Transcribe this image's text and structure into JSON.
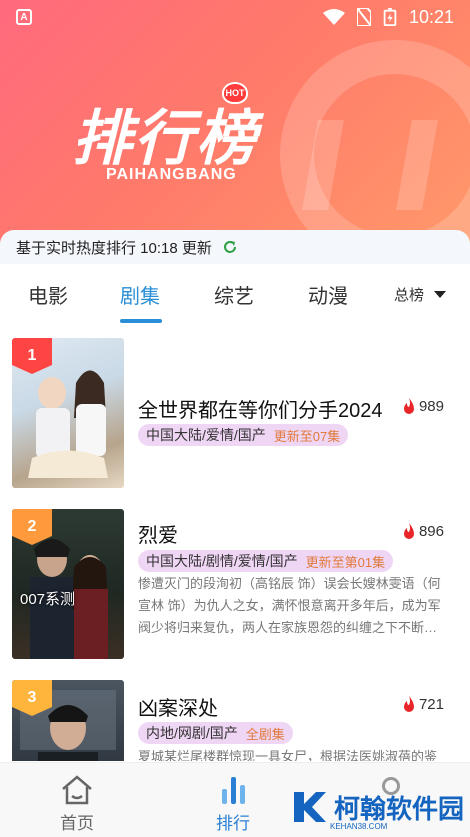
{
  "status": {
    "time": "10:21",
    "app_icon": "A"
  },
  "header": {
    "title": "排行榜",
    "subtitle": "PAIHANGBANG",
    "hot": "HOT"
  },
  "update": {
    "text": "基于实时热度排行 10:18 更新"
  },
  "tabs": [
    {
      "label": "电影"
    },
    {
      "label": "剧集",
      "active": true
    },
    {
      "label": "综艺"
    },
    {
      "label": "动漫"
    }
  ],
  "filter": {
    "label": "总榜"
  },
  "items": [
    {
      "rank": "1",
      "title": "全世界都在等你们分手2024",
      "heat": "989",
      "tags": "中国大陆/爱情/国产",
      "update": "更新至07集",
      "desc": ""
    },
    {
      "rank": "2",
      "title": "烈爱",
      "heat": "896",
      "tags": "中国大陆/剧情/爱情/国产",
      "update": "更新至第01集",
      "desc": "惨遭灭门的段洵初（高铭辰 饰）误会长嫂林雯语（何宣林 饰）为仇人之女，满怀恨意离开多年后，成为军阀少将归来复仇，两人在家族恩怨的纠缠之下不断…",
      "poster_text": "007系测"
    },
    {
      "rank": "3",
      "title": "凶案深处",
      "heat": "721",
      "tags": "内地/网剧/国产",
      "update": "全剧集",
      "desc": "夏城某烂尾楼群惊现一具女尸，根据法医姚淑蓓的鉴"
    }
  ],
  "nav": [
    {
      "label": "首页"
    },
    {
      "label": "排行",
      "active": true
    }
  ],
  "watermark": {
    "text": "柯翰软件园",
    "sub": "KEHAN38.COM"
  },
  "colors": {
    "accent": "#2a8fd6",
    "header_start": "#ff6a7d",
    "header_end": "#ff9a6a",
    "flame": "#e8262a",
    "tag_bg": "#f0d6f5"
  }
}
